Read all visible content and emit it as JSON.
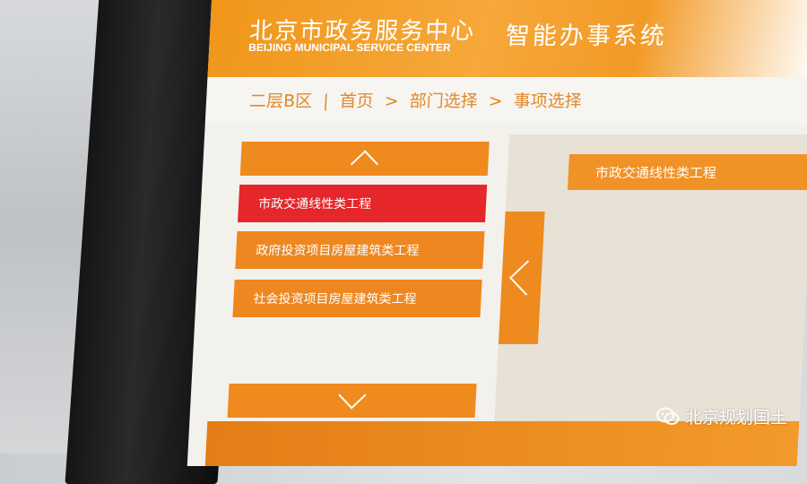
{
  "header": {
    "title_cn": "北京市政务服务中心",
    "title_en": "BEIJING MUNICIPAL SERVICE CENTER",
    "system_name": "智能办事系统"
  },
  "breadcrumb": {
    "location": "二层B区",
    "separator": "|",
    "home": "首页",
    "arrow": ">",
    "department": "部门选择",
    "item": "事项选择"
  },
  "list": {
    "up_icon": "chevron-up-icon",
    "down_icon": "chevron-down-icon",
    "items": [
      {
        "label": "市政交通线性类工程",
        "selected": true
      },
      {
        "label": "政府投资项目房屋建筑类工程",
        "selected": false
      },
      {
        "label": "社会投资项目房屋建筑类工程",
        "selected": false
      }
    ]
  },
  "panel": {
    "back_icon": "chevron-left-icon",
    "selected_label": "市政交通线性类工程"
  },
  "watermark": {
    "text": "北京规划国土",
    "icon": "wechat-icon"
  },
  "colors": {
    "accent": "#ef8a1e",
    "selected": "#e5262a",
    "panel_bg": "#e8e1d6"
  }
}
